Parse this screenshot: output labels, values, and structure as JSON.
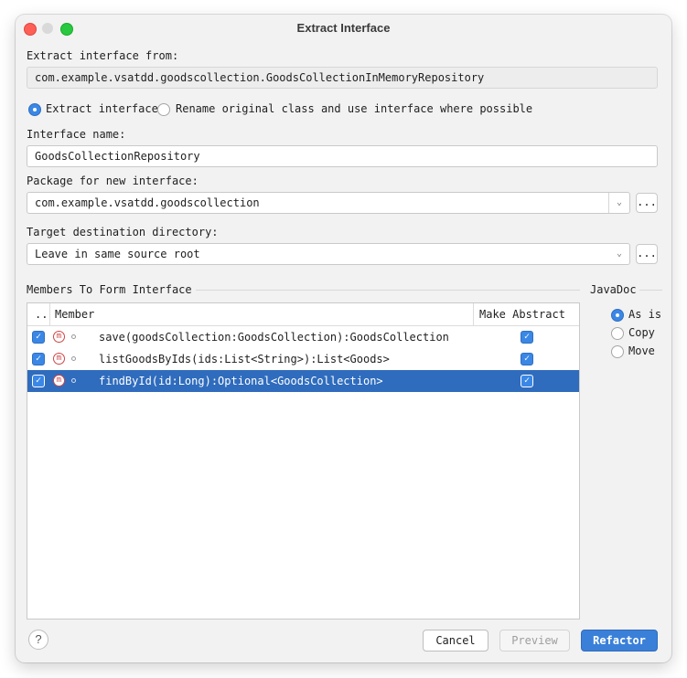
{
  "window": {
    "title": "Extract Interface"
  },
  "extract_from": {
    "label": "Extract interface from:",
    "value": "com.example.vsatdd.goodscollection.GoodsCollectionInMemoryRepository"
  },
  "mode": {
    "extract_label": "Extract interface",
    "rename_label": "Rename original class and use interface where possible",
    "selected": "extract"
  },
  "interface_name": {
    "label": "Interface name:",
    "value": "GoodsCollectionRepository"
  },
  "package": {
    "label": "Package for new interface:",
    "value": "com.example.vsatdd.goodscollection",
    "browse": "..."
  },
  "target_dir": {
    "label": "Target destination directory:",
    "value": "Leave in same source root",
    "browse": "..."
  },
  "members": {
    "section_label": "Members To Form Interface",
    "headers": {
      "check": "..",
      "member": "Member",
      "abstract": "Make Abstract"
    },
    "rows": [
      {
        "checked": true,
        "signature": "save(goodsCollection:GoodsCollection):GoodsCollection",
        "abstract": true,
        "selected": false
      },
      {
        "checked": true,
        "signature": "listGoodsByIds(ids:List<String>):List<Goods>",
        "abstract": true,
        "selected": false
      },
      {
        "checked": true,
        "signature": "findById(id:Long):Optional<GoodsCollection>",
        "abstract": true,
        "selected": true
      }
    ]
  },
  "javadoc": {
    "label": "JavaDoc",
    "options": [
      "As is",
      "Copy",
      "Move"
    ],
    "selected": "As is"
  },
  "buttons": {
    "help": "?",
    "cancel": "Cancel",
    "preview": "Preview",
    "refactor": "Refactor"
  },
  "colors": {
    "accent": "#3a87e6",
    "selection": "#2f6cbd",
    "method_icon": "#d04545"
  }
}
